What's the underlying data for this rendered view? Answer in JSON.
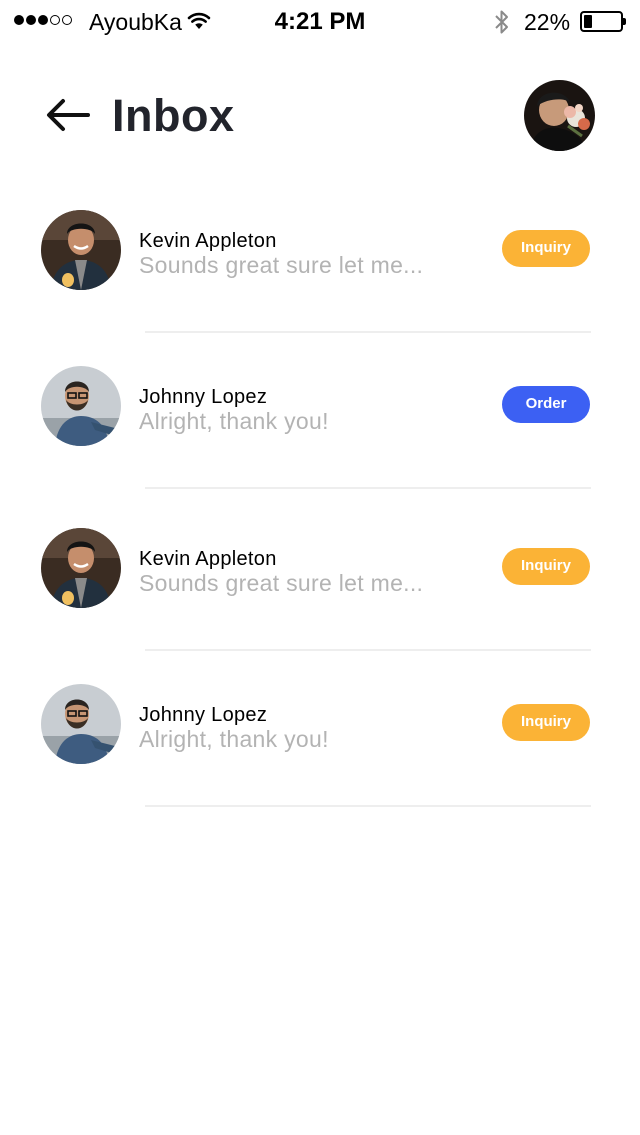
{
  "status_bar": {
    "carrier": "AyoubKa",
    "time": "4:21 PM",
    "battery_percent": "22%",
    "battery_level": 0.22,
    "signal_filled": 3,
    "signal_total": 5
  },
  "header": {
    "title": "Inbox",
    "back_icon": "arrow-left-icon"
  },
  "messages": [
    {
      "sender": "Kevin Appleton",
      "preview": "Sounds great sure let me...",
      "tag": "Inquiry",
      "tag_type": "inquiry"
    },
    {
      "sender": "Johnny Lopez",
      "preview": "Alright, thank you!",
      "tag": "Order",
      "tag_type": "order"
    },
    {
      "sender": "Kevin Appleton",
      "preview": "Sounds great sure let me...",
      "tag": "Inquiry",
      "tag_type": "inquiry"
    },
    {
      "sender": "Johnny Lopez",
      "preview": "Alright, thank you!",
      "tag": "Inquiry",
      "tag_type": "inquiry"
    }
  ],
  "colors": {
    "inquiry": "#fbb336",
    "order": "#3c60f3",
    "title": "#22242c",
    "preview": "#b3b3b3"
  }
}
